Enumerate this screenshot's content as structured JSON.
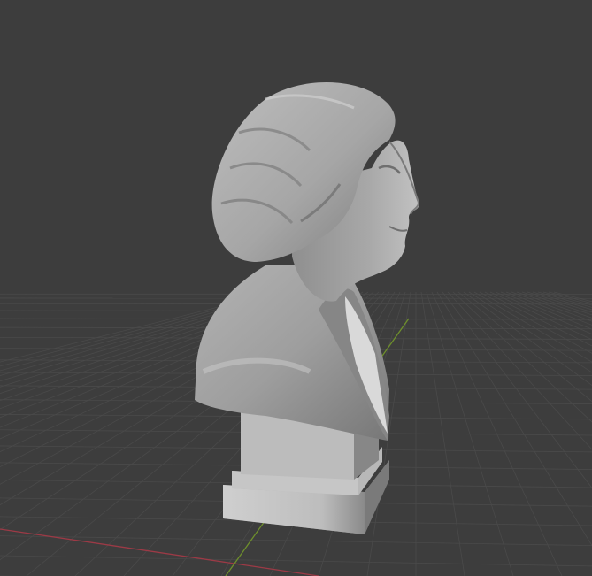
{
  "viewport": {
    "background_color": "#3d3d3d",
    "grid_line_color": "#4a4a4a",
    "x_axis_color": "#9c3a46",
    "y_axis_color": "#6e8f2c"
  },
  "object": {
    "kind": "sculpture-bust",
    "material_color": "#a9a9a9",
    "shadow_color": "#6f6f6f",
    "highlight_color": "#c9c9c9"
  }
}
